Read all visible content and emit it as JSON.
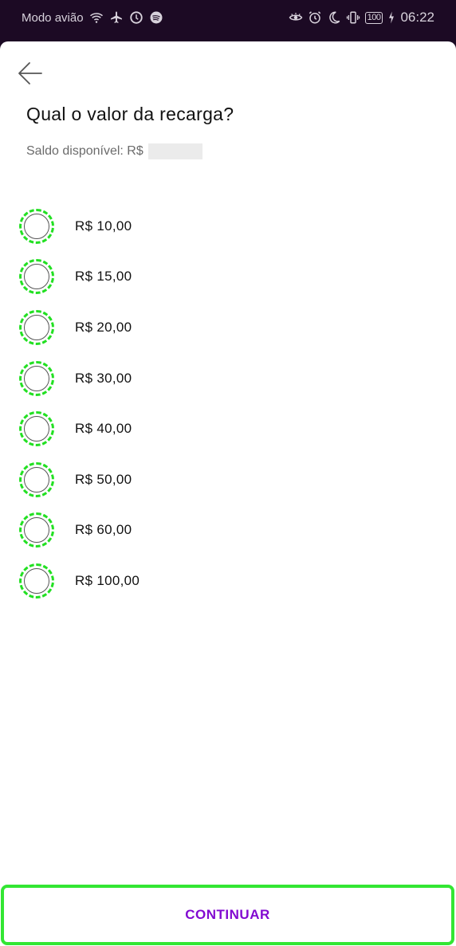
{
  "status_bar": {
    "mode_text": "Modo avião",
    "battery": "100",
    "time": "06:22",
    "left_icons": [
      "wifi-icon",
      "airplane-icon",
      "data-saver-icon",
      "spotify-icon"
    ],
    "right_icons": [
      "eye-comfort-icon",
      "alarm-icon",
      "moon-icon",
      "vibrate-icon",
      "battery-icon",
      "charging-icon"
    ]
  },
  "header": {
    "back_icon": "arrow-left-icon",
    "title": "Qual o valor da recarga?",
    "balance_label": "Saldo disponível: R$"
  },
  "options": [
    {
      "label": "R$ 10,00"
    },
    {
      "label": "R$ 15,00"
    },
    {
      "label": "R$ 20,00"
    },
    {
      "label": "R$ 30,00"
    },
    {
      "label": "R$ 40,00"
    },
    {
      "label": "R$ 50,00"
    },
    {
      "label": "R$ 60,00"
    },
    {
      "label": "R$ 100,00"
    }
  ],
  "footer": {
    "continue_label": "CONTINUAR"
  },
  "colors": {
    "accent": "#820ad1",
    "highlight": "#33e633",
    "status_bar_bg": "#1c0a24"
  }
}
